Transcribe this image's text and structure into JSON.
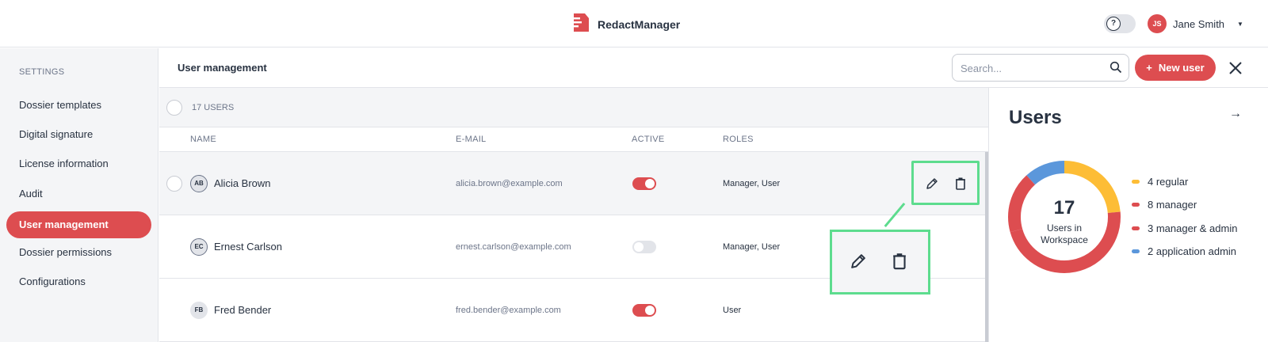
{
  "colors": {
    "accent": "#dd4d50",
    "highlight": "#5ddc8e",
    "regular": "#fdbd36",
    "manager": "#dd4d50",
    "manager_admin": "#dd4d50",
    "app_admin": "#5b97db"
  },
  "topbar": {
    "app_name": "RedactManager",
    "help_icon": "?",
    "user_initials": "JS",
    "user_name": "Jane Smith"
  },
  "sidebar": {
    "heading": "SETTINGS",
    "items": [
      {
        "label": "Dossier templates"
      },
      {
        "label": "Digital signature"
      },
      {
        "label": "License information"
      },
      {
        "label": "Audit"
      },
      {
        "label": "User management",
        "active": true
      },
      {
        "label": "Dossier permissions"
      },
      {
        "label": "Configurations"
      }
    ]
  },
  "main": {
    "title": "User management",
    "search": {
      "placeholder": "Search...",
      "value": ""
    },
    "new_user_label": "New user",
    "users_count": "17 USERS",
    "columns": {
      "name": "NAME",
      "email": "E-MAIL",
      "active": "ACTIVE",
      "roles": "ROLES"
    },
    "rows": [
      {
        "initials": "AB",
        "name": "Alicia Brown",
        "email": "alicia.brown@example.com",
        "active": true,
        "roles": "Manager, User"
      },
      {
        "initials": "EC",
        "name": "Ernest Carlson",
        "email": "ernest.carlson@example.com",
        "active": false,
        "roles": "Manager, User"
      },
      {
        "initials": "FB",
        "name": "Fred Bender",
        "email": "fred.bender@example.com",
        "active": true,
        "roles": "User"
      }
    ]
  },
  "panel": {
    "title": "Users",
    "total": "17",
    "caption_line1": "Users in",
    "caption_line2": "Workspace",
    "legend": [
      {
        "label": "4 regular",
        "count": 4,
        "color": "#fdbd36"
      },
      {
        "label": "8 manager",
        "count": 8,
        "color": "#dd4d50"
      },
      {
        "label": "3 manager & admin",
        "count": 3,
        "color": "#dd4d50"
      },
      {
        "label": "2 application admin",
        "count": 2,
        "color": "#5b97db"
      }
    ]
  }
}
